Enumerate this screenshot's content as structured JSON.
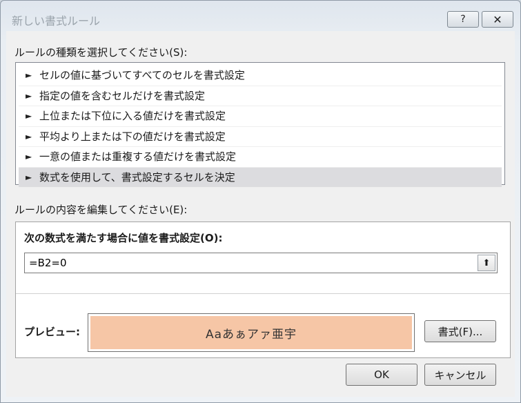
{
  "window": {
    "title": "新しい書式ルール",
    "help_label": "?",
    "close_label": "✕"
  },
  "rule_type": {
    "label": "ルールの種類を選択してください(S):",
    "items": [
      "セルの値に基づいてすべてのセルを書式設定",
      "指定の値を含むセルだけを書式設定",
      "上位または下位に入る値だけを書式設定",
      "平均より上または下の値だけを書式設定",
      "一意の値または重複する値だけを書式設定",
      "数式を使用して、書式設定するセルを決定"
    ],
    "selected_index": 5,
    "arrow_glyph": "►"
  },
  "rule_edit": {
    "label": "ルールの内容を編集してください(E):",
    "formula_label": "次の数式を満たす場合に値を書式設定(O):",
    "formula_value": "=B2=0",
    "collapse_icon": "⬆",
    "preview_label": "プレビュー:",
    "preview_text": "Aaあぁアァ亜宇",
    "preview_color": "#f6c6a6",
    "format_button": "書式(F)..."
  },
  "buttons": {
    "ok": "OK",
    "cancel": "キャンセル"
  }
}
